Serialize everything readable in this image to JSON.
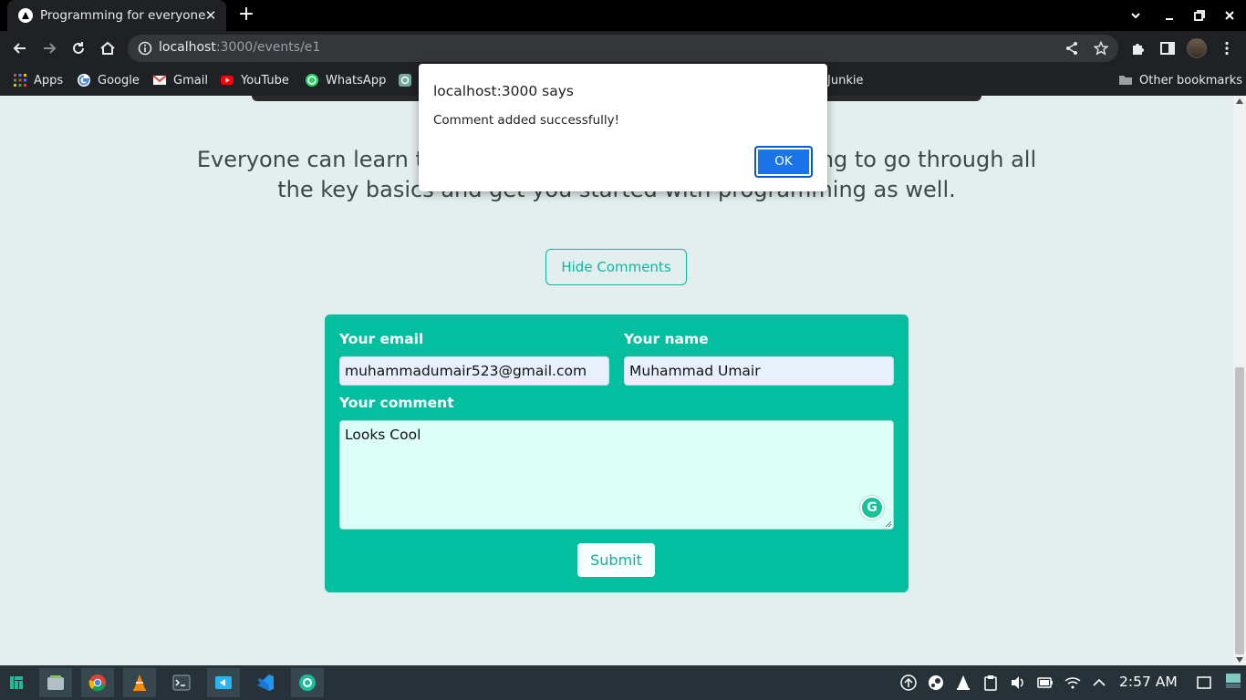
{
  "browser": {
    "tab_title": "Programming for everyone",
    "tab_close": "✕",
    "new_tab": "+",
    "url_host": "localhost",
    "url_path": ":3000/events/e1"
  },
  "bookmarks": {
    "items": [
      {
        "label": "Apps",
        "icon": "apps-grid-icon"
      },
      {
        "label": "Google",
        "icon": "google-icon"
      },
      {
        "label": "Gmail",
        "icon": "gmail-icon"
      },
      {
        "label": "YouTube",
        "icon": "youtube-icon"
      },
      {
        "label": "WhatsApp",
        "icon": "whatsapp-icon"
      },
      {
        "label": "Junkie",
        "icon": ""
      }
    ],
    "other_bookmarks": "Other bookmarks"
  },
  "page": {
    "intro": "Everyone can learn to code! And in this event we are going to go through all the key basics and get you started with programming as well.",
    "hide_comments": "Hide Comments",
    "form": {
      "email_label": "Your email",
      "email_value": "muhammadumair523@gmail.com",
      "name_label": "Your name",
      "name_value": "Muhammad Umair",
      "comment_label": "Your comment",
      "comment_value": "Looks Cool",
      "submit": "Submit"
    }
  },
  "dialog": {
    "title": "localhost:3000 says",
    "message": "Comment added successfully!",
    "ok": "OK"
  },
  "taskbar": {
    "clock": "2:57 AM"
  },
  "colors": {
    "accent": "#03be9f",
    "page_bg": "#e2efee",
    "dialog_button": "#1a73e8"
  }
}
